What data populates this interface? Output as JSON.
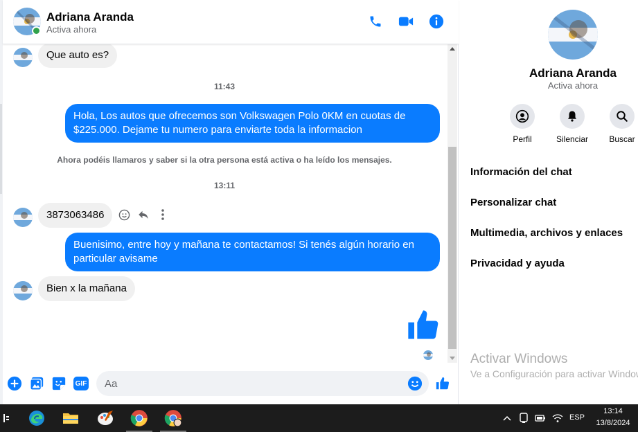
{
  "contact": {
    "name": "Adriana Aranda",
    "status": "Activa ahora"
  },
  "colors": {
    "accent": "#0a7cff",
    "online": "#31a24c",
    "incoming_bubble": "#f0f0f0",
    "taskbar": "#1c1c1c"
  },
  "header": {
    "icons": [
      "phone-icon",
      "video-call-icon",
      "info-icon"
    ]
  },
  "messages": [
    {
      "type": "in",
      "text": "Que auto es?"
    },
    {
      "type": "timestamp",
      "text": "11:43"
    },
    {
      "type": "out",
      "text": "Hola, Los autos que ofrecemos son Volkswagen Polo 0KM en cuotas de $225.000. Dejame tu numero para enviarte toda la informacion"
    },
    {
      "type": "notice",
      "text": "Ahora podéis llamaros y saber si la otra persona está activa o ha leído los mensajes."
    },
    {
      "type": "timestamp",
      "text": "13:11"
    },
    {
      "type": "in",
      "text": "3873063486"
    },
    {
      "type": "out",
      "text": "Buenisimo, entre hoy y mañana te contactamos! Si tenés algún horario en particular avisame"
    },
    {
      "type": "in",
      "text": "Bien x la mañana"
    },
    {
      "type": "out-like",
      "text": ""
    }
  ],
  "composer": {
    "placeholder": "Aa",
    "icons": [
      "add-icon",
      "image-icon",
      "sticker-icon",
      "gif-icon",
      "emoji-icon",
      "like-icon"
    ],
    "gif_label": "GIF"
  },
  "info_panel": {
    "name": "Adriana Aranda",
    "status": "Activa ahora",
    "actions": [
      {
        "label": "Perfil",
        "icon": "profile-icon"
      },
      {
        "label": "Silenciar",
        "icon": "bell-icon"
      },
      {
        "label": "Buscar",
        "icon": "search-icon"
      }
    ],
    "menu": [
      "Información del chat",
      "Personalizar chat",
      "Multimedia, archivos y enlaces",
      "Privacidad y ayuda"
    ]
  },
  "watermark": {
    "title": "Activar Windows",
    "subtitle": "Ve a Configuración para activar Windows."
  },
  "taskbar": {
    "apps": [
      "task-view-icon",
      "edge-icon",
      "file-explorer-icon",
      "paint-icon",
      "chrome-icon",
      "chrome-profile-icon"
    ],
    "language": "ESP",
    "time": "13:14",
    "date": "13/8/2024"
  }
}
